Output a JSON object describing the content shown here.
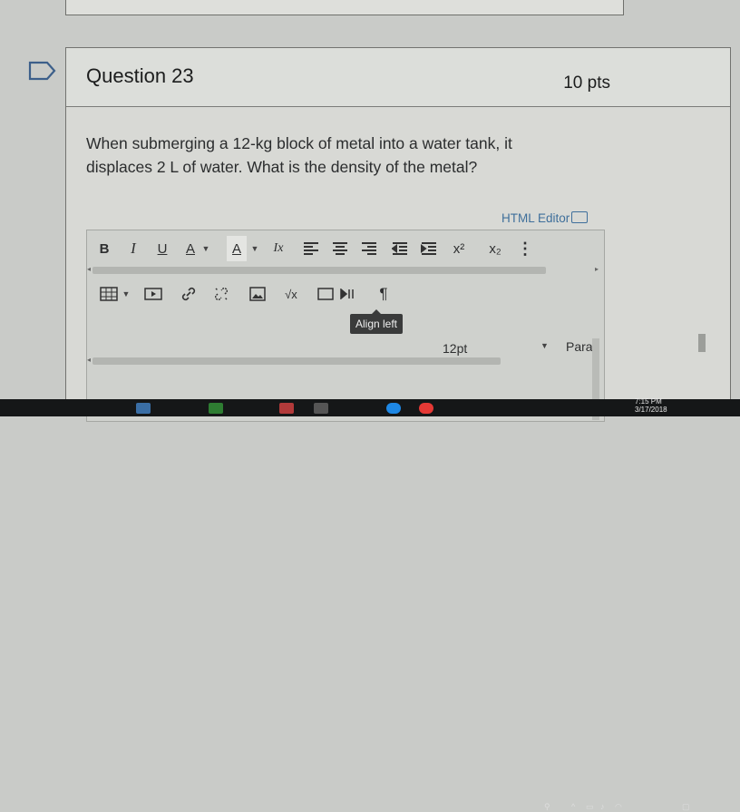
{
  "question": {
    "title": "Question 23",
    "points": "10 pts",
    "text": "When submerging a 12-kg block of metal into a water tank, it displaces 2 L of water. What is the density of the metal?"
  },
  "editor": {
    "html_editor_label": "HTML Editor",
    "toolbar1": {
      "bold": "B",
      "italic": "I",
      "underline": "U",
      "text_color": "A",
      "bg_color": "A",
      "clear_format": "Ix",
      "superscript": "x²",
      "subscript": "x₂",
      "more": "⋮"
    },
    "toolbar2": {
      "font_size": "12pt",
      "paragraph": "Parag",
      "sqrt": "√x"
    },
    "tooltip": "Align left"
  },
  "taskbar": {
    "time": "7:15 PM",
    "date": "3/17/2018"
  },
  "colors": {
    "link": "#3f6f9b",
    "tooltip_bg": "#3a3b3b"
  }
}
